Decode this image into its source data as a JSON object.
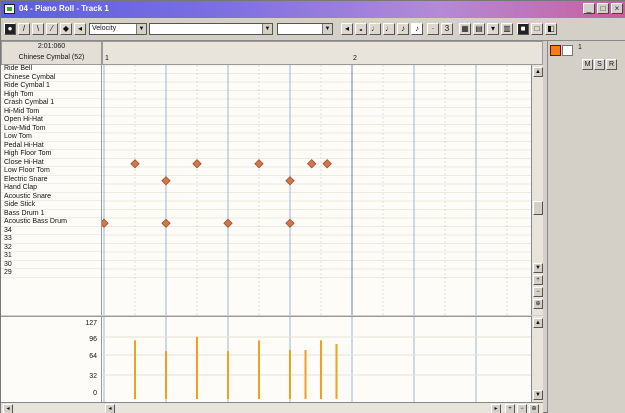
{
  "window": {
    "title": "04 - Piano Roll - Track 1"
  },
  "toolbar": {
    "controller": "Velocity",
    "dropdown2": "",
    "dropdown3": ""
  },
  "header": {
    "position": "2:01:060",
    "instrument": "Chinese Cymbal (52)"
  },
  "timeline": {
    "markers": [
      "1",
      "2"
    ]
  },
  "panel": {
    "track_number": "1",
    "buttons": [
      "M",
      "S",
      "R"
    ]
  },
  "drum_map": [
    "Ride Bell",
    "Chinese Cymbal",
    "Ride Cymbal 1",
    "High Tom",
    "Crash Cymbal 1",
    "Hi-Mid Tom",
    "Open Hi-Hat",
    "Low-Mid Tom",
    "Low Tom",
    "Pedal Hi-Hat",
    "High Floor Tom",
    "Close Hi-Hat",
    "Low Floor Tom",
    "Electric Snare",
    "Hand Clap",
    "Acoustic Snare",
    "Side Stick",
    "Bass Drum 1",
    "Acoustic Bass Drum",
    "34",
    "33",
    "32",
    "31",
    "30",
    "29"
  ],
  "notes": [
    {
      "row": 11,
      "time": 0.5
    },
    {
      "row": 11,
      "time": 1.5
    },
    {
      "row": 11,
      "time": 2.5
    },
    {
      "row": 11,
      "time": 3.35
    },
    {
      "row": 11,
      "time": 3.6
    },
    {
      "row": 13,
      "time": 1.0
    },
    {
      "row": 13,
      "time": 3.0
    },
    {
      "row": 18,
      "time": 0.0
    },
    {
      "row": 18,
      "time": 1.0
    },
    {
      "row": 18,
      "time": 2.0
    },
    {
      "row": 18,
      "time": 3.0
    }
  ],
  "velocity_scale": [
    "127",
    "96",
    "64",
    "32",
    "0"
  ],
  "velocities": [
    {
      "time": 0.5,
      "value": 98
    },
    {
      "time": 1.0,
      "value": 80
    },
    {
      "time": 1.5,
      "value": 104
    },
    {
      "time": 2.0,
      "value": 80
    },
    {
      "time": 2.5,
      "value": 98
    },
    {
      "time": 3.0,
      "value": 82
    },
    {
      "time": 3.25,
      "value": 82
    },
    {
      "time": 3.5,
      "value": 98
    },
    {
      "time": 3.75,
      "value": 92
    }
  ],
  "colors": {
    "note": "#d2774a",
    "velocity": "#f0a020",
    "grid_beat": "#9fb6cf",
    "grid_sub": "#d7dfe8"
  }
}
